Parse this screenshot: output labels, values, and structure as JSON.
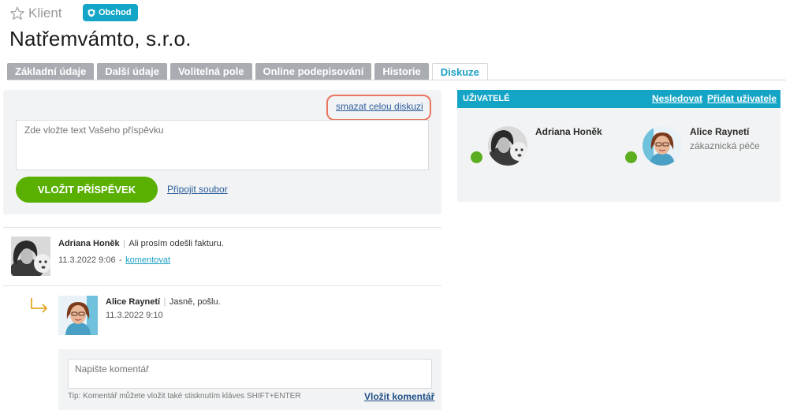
{
  "header": {
    "kind": "Klient",
    "badge": "Obchod",
    "title": "Natřemvámto, s.r.o."
  },
  "tabs": [
    {
      "label": "Základní údaje",
      "active": false
    },
    {
      "label": "Další údaje",
      "active": false
    },
    {
      "label": "Volitelná pole",
      "active": false
    },
    {
      "label": "Online podepisování",
      "active": false
    },
    {
      "label": "Historie",
      "active": false
    },
    {
      "label": "Diskuze",
      "active": true
    }
  ],
  "composer": {
    "delete_all": "smazat celou diskuzi",
    "placeholder": "Zde vložte text Vašeho příspěvku",
    "submit": "VLOŽIT PŘÍSPĚVEK",
    "attach": "Připojit soubor"
  },
  "users": {
    "title": "UŽIVATELÉ",
    "unfollow": "Nesledovat",
    "add": "Přidat uživatele",
    "list": [
      {
        "name": "Adriana Honěk",
        "role": "",
        "online": true
      },
      {
        "name": "Alice Raynetí",
        "role": "zákaznická péče",
        "online": true
      }
    ]
  },
  "feed": {
    "posts": [
      {
        "author": "Adriana Honěk",
        "text": "Ali prosím odešli fakturu.",
        "time": "11.3.2022 9:06",
        "comment_link": "komentovat"
      },
      {
        "author": "Alice Raynetí",
        "text": "Jasně, pošlu.",
        "time": "11.3.2022 9:10"
      }
    ],
    "separator": "|",
    "time_separator": "-",
    "comment_placeholder": "Napište komentář",
    "comment_tip": "Tip: Komentář můžete vložit také stisknutím kláves SHIFT+ENTER",
    "comment_submit": "Vložit komentář"
  },
  "colors": {
    "accent": "#14a4c6",
    "submit_green": "#59b000",
    "online": "#5cad1f",
    "highlight": "#e8765f",
    "tab_inactive": "#a9adb2"
  }
}
